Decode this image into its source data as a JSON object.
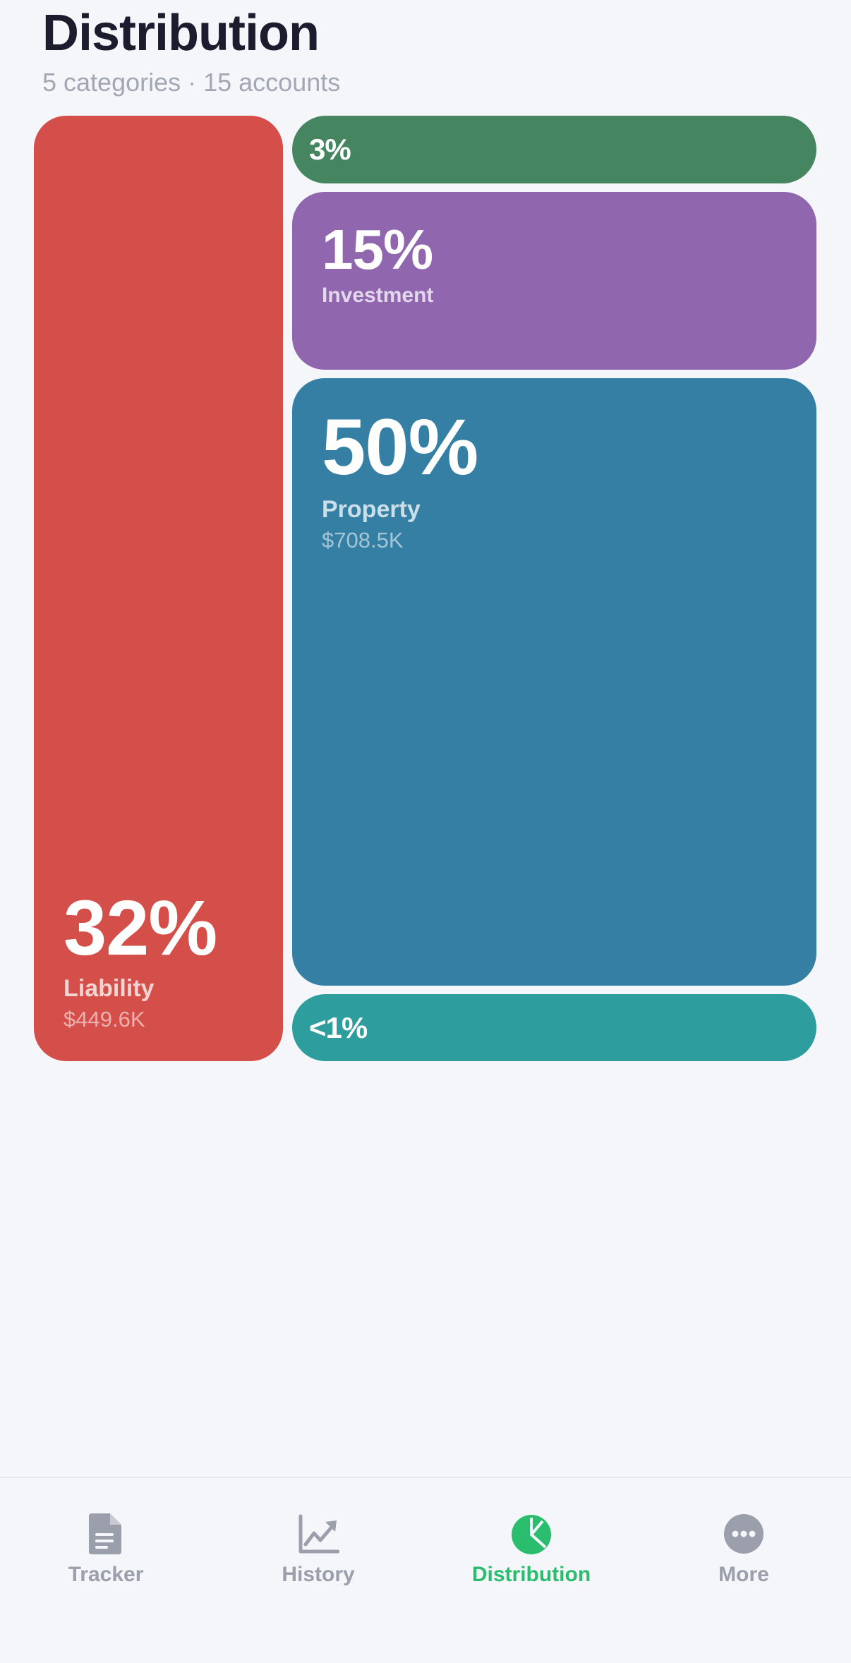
{
  "header": {
    "title": "Distribution",
    "subtitle": "5 categories · 15 accounts"
  },
  "tiles": {
    "liability": {
      "percent": "32%",
      "category": "Liability",
      "amount": "$449.6K",
      "color": "#d44f49"
    },
    "unlabeled_green": {
      "percent": "3%",
      "color": "#458661"
    },
    "investment": {
      "percent": "15%",
      "category": "Investment",
      "color": "#9066ae"
    },
    "property": {
      "percent": "50%",
      "category": "Property",
      "amount": "$708.5K",
      "color": "#357fa5"
    },
    "unlabeled_teal": {
      "percent": "<1%",
      "color": "#2e9d9d"
    }
  },
  "tabbar": {
    "active_color": "#2bbd6e",
    "inactive_color": "#9a9fab",
    "items": [
      {
        "label": "Tracker",
        "icon": "document-icon"
      },
      {
        "label": "History",
        "icon": "chart-line-icon"
      },
      {
        "label": "Distribution",
        "icon": "pie-chart-icon",
        "active": true
      },
      {
        "label": "More",
        "icon": "more-dots-icon"
      }
    ]
  }
}
